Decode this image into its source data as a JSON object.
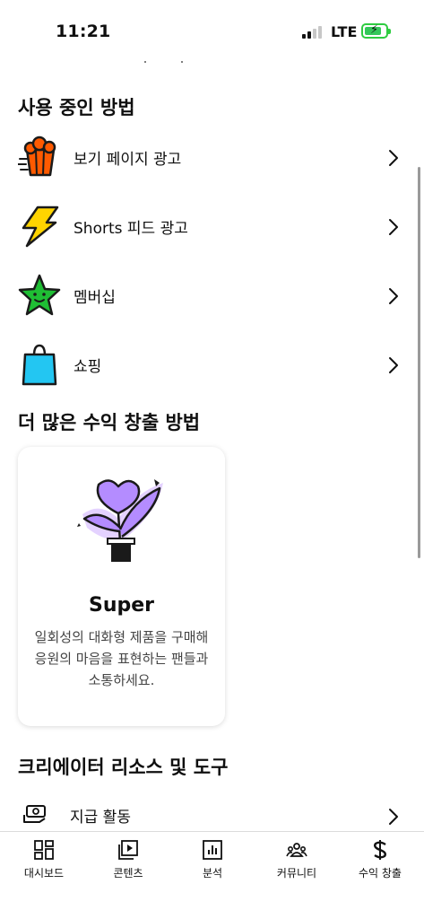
{
  "status_bar": {
    "time": "11:21",
    "network": "LTE",
    "icons": [
      "signal-icon",
      "battery-charging-icon"
    ]
  },
  "sections": {
    "active_methods_title": "사용 중인 방법",
    "more_methods_title": "더 많은 수익 창출 방법",
    "creator_resources_title": "크리에이터 리소스 및 도구"
  },
  "active_methods": [
    {
      "label": "보기 페이지 광고",
      "icon": "popcorn-icon",
      "color": "#ff5a00"
    },
    {
      "label": "Shorts 피드 광고",
      "icon": "lightning-icon",
      "color": "#ffd400"
    },
    {
      "label": "멤버십",
      "icon": "star-icon",
      "color": "#1fbe34"
    },
    {
      "label": "쇼핑",
      "icon": "shopping-bag-icon",
      "color": "#23c6f2"
    }
  ],
  "super_card": {
    "title": "Super",
    "description": "일회성의 대화형 제품을 구매해 응원의 마음을 표현하는 팬들과 소통하세요.",
    "icon": "plant-heart-icon",
    "accent": "#b48cff"
  },
  "resources": [
    {
      "label": "지급 활동",
      "icon": "money-hand-icon"
    }
  ],
  "tab_bar": {
    "tabs": [
      {
        "label": "대시보드",
        "icon": "dashboard-icon"
      },
      {
        "label": "콘텐츠",
        "icon": "content-icon"
      },
      {
        "label": "분석",
        "icon": "analytics-icon"
      },
      {
        "label": "커뮤니티",
        "icon": "community-icon"
      },
      {
        "label": "수익 창출",
        "icon": "dollar-icon"
      }
    ]
  }
}
